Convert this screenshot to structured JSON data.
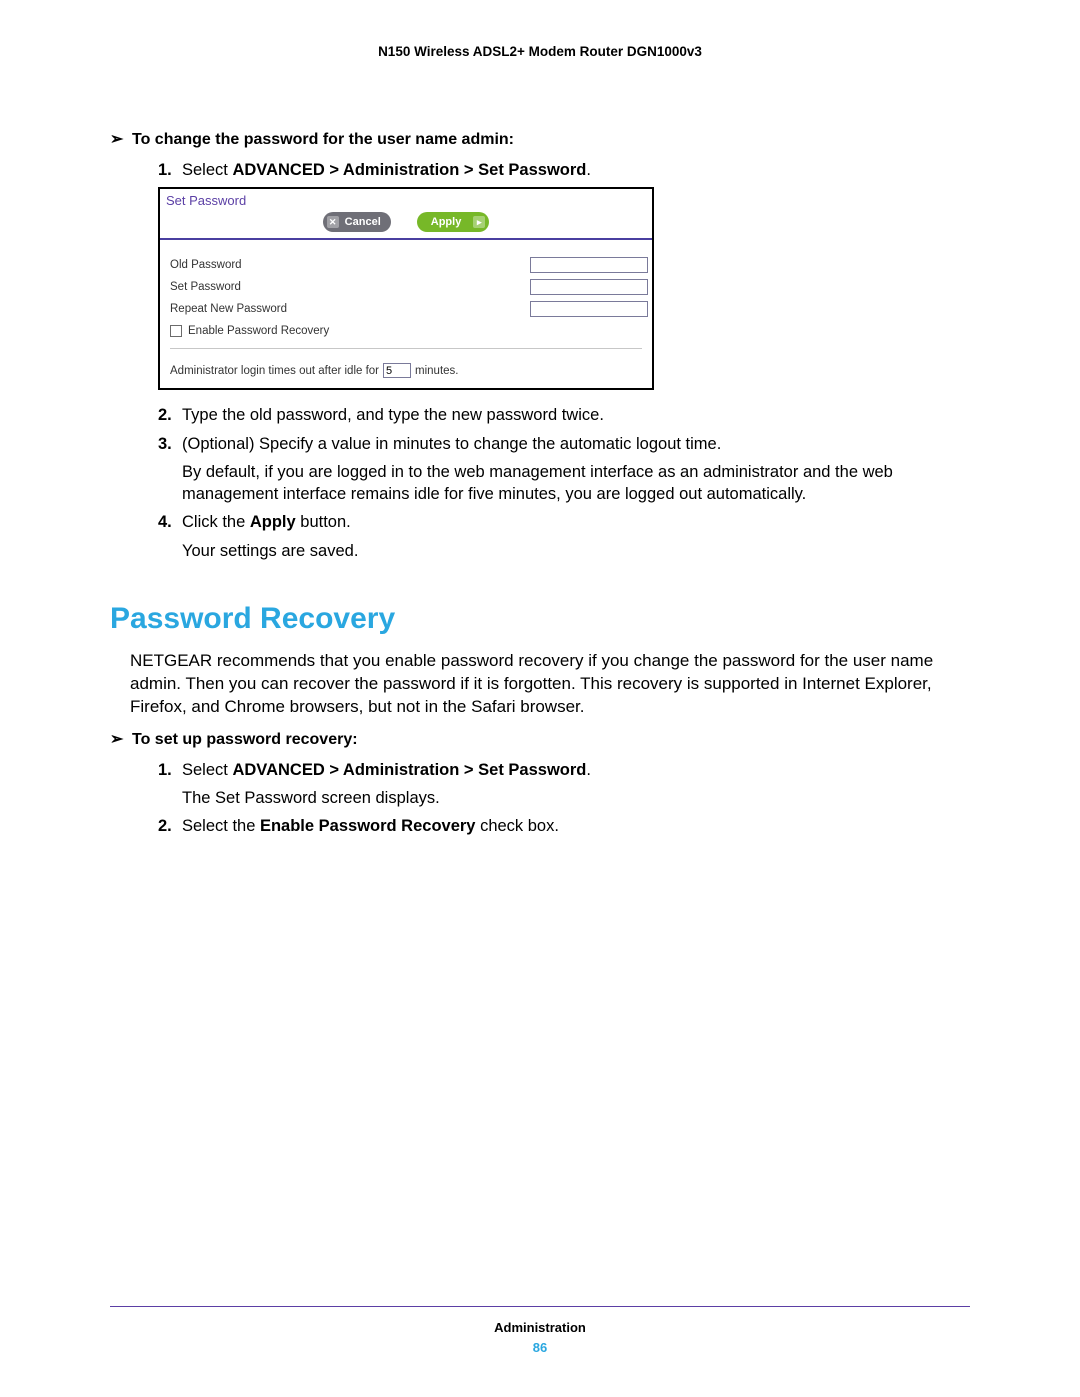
{
  "doc_title": "N150 Wireless ADSL2+ Modem Router DGN1000v3",
  "proc1_heading": "To change the password for the user name admin:",
  "steps1": {
    "s1_pre": "Select ",
    "s1_bold": "ADVANCED > Administration > Set Password",
    "s1_post": ".",
    "s2": "Type the old password, and type the new password twice.",
    "s3": "(Optional) Specify a value in minutes to change the automatic logout time.",
    "s3_cont": "By default, if you are logged in to the web management interface as an administrator and the web management interface remains idle for five minutes, you are logged out automatically.",
    "s4_pre": "Click the ",
    "s4_bold": "Apply",
    "s4_post": " button.",
    "s4_cont": "Your settings are saved."
  },
  "screenshot": {
    "title": "Set Password",
    "cancel": "Cancel",
    "apply": "Apply",
    "old_pw": "Old Password",
    "set_pw": "Set Password",
    "repeat_pw": "Repeat New Password",
    "enable_recovery": "Enable Password Recovery",
    "timeout_pre": "Administrator login times out after idle for",
    "timeout_val": "5",
    "timeout_post": "minutes."
  },
  "h2": "Password Recovery",
  "recovery_para": "NETGEAR recommends that you enable password recovery if you change the password for the user name admin. Then you can recover the password if it is forgotten. This recovery is supported in Internet Explorer, Firefox, and Chrome browsers, but not in the Safari browser.",
  "proc2_heading": "To set up password recovery:",
  "steps2": {
    "s1_pre": "Select ",
    "s1_bold": "ADVANCED > Administration > Set Password",
    "s1_post": ".",
    "s1_cont": "The Set Password screen displays.",
    "s2_pre": "Select the ",
    "s2_bold": "Enable Password Recovery",
    "s2_post": " check box."
  },
  "footer_section": "Administration",
  "page_no": "86"
}
